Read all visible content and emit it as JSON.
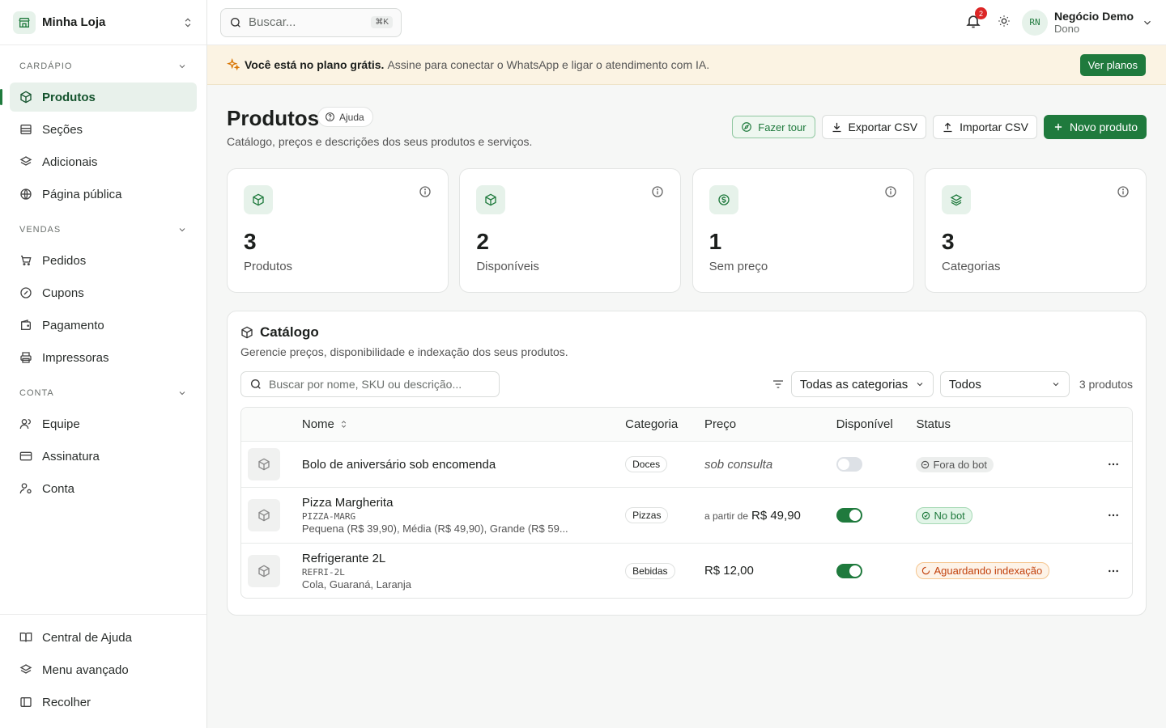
{
  "store": {
    "name": "Minha Loja"
  },
  "sidebar": {
    "groups": [
      {
        "title": "CARDÁPIO",
        "items": [
          {
            "label": "Produtos"
          },
          {
            "label": "Seções"
          },
          {
            "label": "Adicionais"
          },
          {
            "label": "Página pública"
          }
        ]
      },
      {
        "title": "VENDAS",
        "items": [
          {
            "label": "Pedidos"
          },
          {
            "label": "Cupons"
          },
          {
            "label": "Pagamento"
          },
          {
            "label": "Impressoras"
          }
        ]
      },
      {
        "title": "CONTA",
        "items": [
          {
            "label": "Equipe"
          },
          {
            "label": "Assinatura"
          },
          {
            "label": "Conta"
          }
        ]
      }
    ],
    "footer": [
      {
        "label": "Central de Ajuda"
      },
      {
        "label": "Menu avançado"
      },
      {
        "label": "Recolher"
      }
    ]
  },
  "topbar": {
    "search_placeholder": "Buscar...",
    "shortcut": "⌘K",
    "notifications": "2",
    "user_initials": "RN",
    "user_name": "Negócio Demo",
    "user_role": "Dono"
  },
  "banner": {
    "bold": "Você está no plano grátis.",
    "text": "Assine para conectar o WhatsApp e ligar o atendimento com IA.",
    "button": "Ver planos"
  },
  "page": {
    "title": "Produtos",
    "help": "Ajuda",
    "subtitle": "Catálogo, preços e descrições dos seus produtos e serviços.",
    "actions": {
      "tour": "Fazer tour",
      "export": "Exportar CSV",
      "import": "Importar CSV",
      "new": "Novo produto"
    }
  },
  "stats": [
    {
      "value": "3",
      "label": "Produtos"
    },
    {
      "value": "2",
      "label": "Disponíveis"
    },
    {
      "value": "1",
      "label": "Sem preço"
    },
    {
      "value": "3",
      "label": "Categorias"
    }
  ],
  "catalog": {
    "title": "Catálogo",
    "subtitle": "Gerencie preços, disponibilidade e indexação dos seus produtos.",
    "search_placeholder": "Buscar por nome, SKU ou descrição...",
    "category_filter": "Todas as categorias",
    "status_filter": "Todos",
    "count": "3 produtos",
    "columns": {
      "name": "Nome",
      "category": "Categoria",
      "price": "Preço",
      "available": "Disponível",
      "status": "Status"
    },
    "rows": [
      {
        "name": "Bolo de aniversário sob encomenda",
        "sku": "",
        "variants": "",
        "category": "Doces",
        "price_prefix": "",
        "price": "sob consulta",
        "available": false,
        "status": "Fora do bot"
      },
      {
        "name": "Pizza Margherita",
        "sku": "PIZZA-MARG",
        "variants": "Pequena (R$ 39,90), Média (R$ 49,90), Grande (R$ 59...",
        "category": "Pizzas",
        "price_prefix": "a partir de",
        "price": "R$ 49,90",
        "available": true,
        "status": "No bot"
      },
      {
        "name": "Refrigerante 2L",
        "sku": "REFRI-2L",
        "variants": "Cola, Guaraná, Laranja",
        "category": "Bebidas",
        "price_prefix": "",
        "price": "R$ 12,00",
        "available": true,
        "status": "Aguardando indexação"
      }
    ]
  },
  "colors": {
    "brand": "#1f7a3d",
    "banner_bg": "#fbf3e3",
    "badge_orange": "#c2410c",
    "badge_red": "#dc2626"
  }
}
